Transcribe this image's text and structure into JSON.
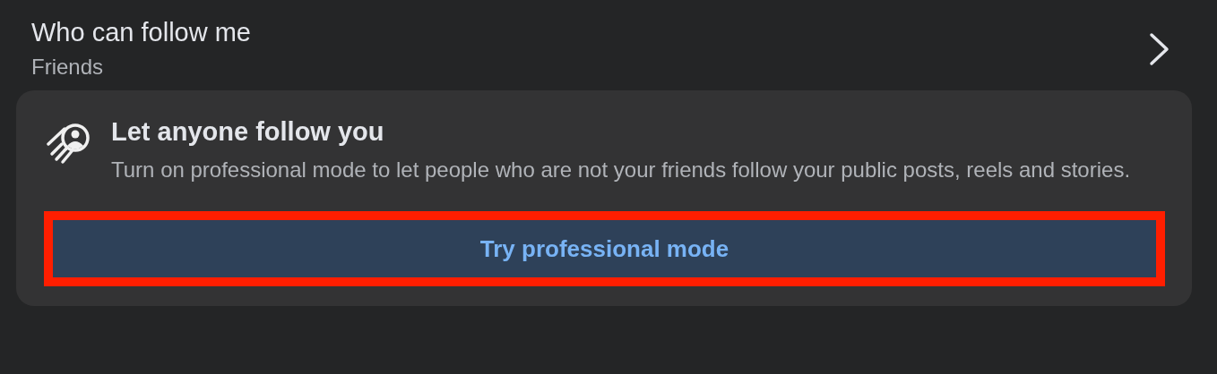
{
  "setting": {
    "title": "Who can follow me",
    "value": "Friends"
  },
  "promo": {
    "title": "Let anyone follow you",
    "text": "Turn on professional mode to let people who are not your friends follow your public posts, reels and stories.",
    "button": {
      "label": "Try professional mode",
      "highlighted": true
    }
  }
}
